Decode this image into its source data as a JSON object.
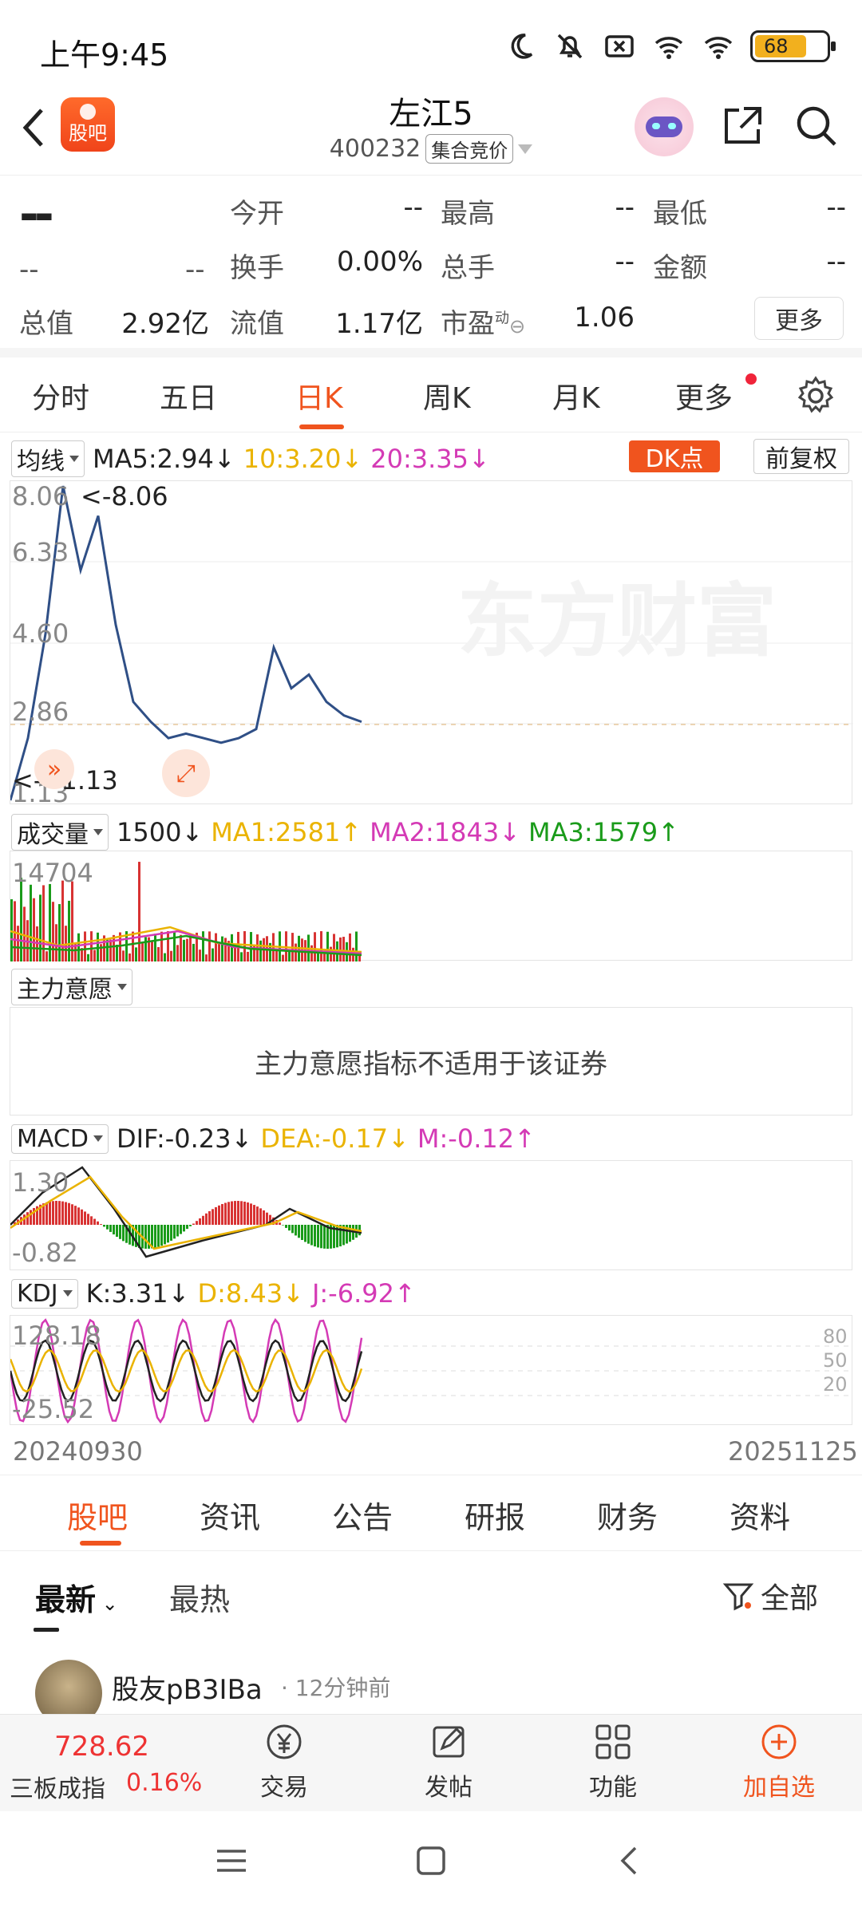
{
  "status": {
    "time": "上午9:45",
    "battery": "68"
  },
  "header": {
    "title": "左江5",
    "code": "400232",
    "badge": "集合竞价",
    "logo_text": "股吧"
  },
  "quote": {
    "price": "--",
    "change": "--",
    "change_pct": "--",
    "fields": [
      {
        "label": "今开",
        "value": "--"
      },
      {
        "label": "最高",
        "value": "--"
      },
      {
        "label": "最低",
        "value": "--"
      },
      {
        "label": "换手",
        "value": "0.00%"
      },
      {
        "label": "总手",
        "value": "--"
      },
      {
        "label": "金额",
        "value": "--"
      },
      {
        "label": "总值",
        "value": "2.92亿"
      },
      {
        "label": "流值",
        "value": "1.17亿"
      },
      {
        "label": "市盈",
        "value": "1.06"
      }
    ],
    "pe_sup": "动",
    "more": "更多"
  },
  "chart_tabs": [
    "分时",
    "五日",
    "日K",
    "周K",
    "月K",
    "更多"
  ],
  "active_tab": "日K",
  "ma_legend": {
    "selector": "均线",
    "ma5": "MA5:2.94↓",
    "ma10": "10:3.20↓",
    "ma20": "20:3.35↓",
    "dk": "DK点",
    "adjust": "前复权"
  },
  "main_axis": {
    "top": "8.06",
    "l2": "6.33",
    "l3": "4.60",
    "l4": "2.86",
    "bottom": "1.13",
    "max_note": "<-8.06",
    "min_note": "<---1.13",
    "watermark": "东方财富"
  },
  "volume": {
    "selector": "成交量",
    "v": "1500↓",
    "ma1": "MA1:2581↑",
    "ma2": "MA2:1843↓",
    "ma3": "MA3:1579↑",
    "axis_top": "14704"
  },
  "zlyy": {
    "selector": "主力意愿",
    "notice": "主力意愿指标不适用于该证券"
  },
  "macd": {
    "selector": "MACD",
    "dif": "DIF:-0.23↓",
    "dea": "DEA:-0.17↓",
    "m": "M:-0.12↑",
    "axis_top": "1.30",
    "axis_bottom": "-0.82"
  },
  "kdj": {
    "selector": "KDJ",
    "k": "K:3.31↓",
    "d": "D:8.43↓",
    "j": "J:-6.92↑",
    "axis_top": "128.18",
    "axis_bottom": "-25.52",
    "r80": "80",
    "r50": "50",
    "r20": "20"
  },
  "dates": {
    "start": "20240930",
    "end": "20251125"
  },
  "bottom_tabs": [
    "股吧",
    "资讯",
    "公告",
    "研报",
    "财务",
    "资料"
  ],
  "filters": {
    "latest": "最新",
    "hot": "最热",
    "all": "全部"
  },
  "post": {
    "user": "股友pB3IBa",
    "time": "· 12分钟前"
  },
  "bottom_nav": {
    "index_value": "728.62",
    "index_name": "三板成指",
    "index_change": "0.16%",
    "items": [
      "交易",
      "发帖",
      "功能",
      "加自选"
    ]
  },
  "colors": {
    "accent": "#f0541e",
    "up": "#e33333",
    "down": "#1a9b1a"
  },
  "chart_data": {
    "type": "line",
    "title": "",
    "x_range": [
      "20240930",
      "20251125"
    ],
    "ylim": [
      1.13,
      8.06
    ],
    "price_series_approx": [
      1.13,
      2.5,
      4.8,
      8.06,
      6.2,
      7.4,
      5.0,
      3.3,
      2.86,
      2.5,
      2.6,
      2.5,
      2.4,
      2.5,
      2.7,
      4.5,
      3.6,
      3.9,
      3.3,
      3.0,
      2.86
    ]
  }
}
